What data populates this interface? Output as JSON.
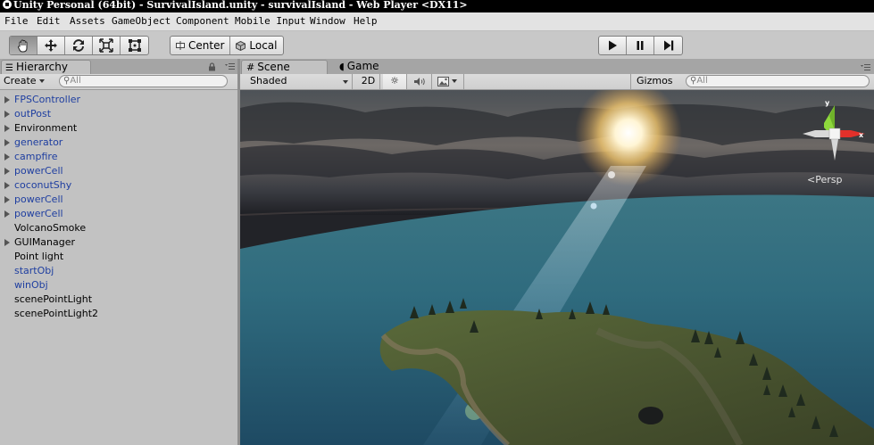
{
  "window": {
    "title": "Unity Personal (64bit) - SurvivalIsland.unity - survivalIsland - Web Player <DX11>"
  },
  "menu": [
    "File",
    "Edit",
    "Assets",
    "GameObject",
    "Component",
    "Mobile Input",
    "Window",
    "Help"
  ],
  "toolbar": {
    "tools": [
      "hand-tool-icon",
      "move-tool-icon",
      "rotate-tool-icon",
      "scale-tool-icon",
      "rect-tool-icon"
    ],
    "active_tool": "hand-tool-icon",
    "pivot_label": "Center",
    "space_label": "Local",
    "playback": [
      "play-icon",
      "pause-icon",
      "step-icon"
    ]
  },
  "hierarchy": {
    "tab_label": "Hierarchy",
    "create_label": "Create",
    "search_placeholder": "All",
    "items": [
      {
        "label": "FPSController",
        "expandable": true,
        "prefab": true
      },
      {
        "label": "outPost",
        "expandable": true,
        "prefab": true
      },
      {
        "label": "Environment",
        "expandable": true,
        "prefab": false
      },
      {
        "label": "generator",
        "expandable": true,
        "prefab": true
      },
      {
        "label": "campfire",
        "expandable": true,
        "prefab": true
      },
      {
        "label": "powerCell",
        "expandable": true,
        "prefab": true
      },
      {
        "label": "coconutShy",
        "expandable": true,
        "prefab": true
      },
      {
        "label": "powerCell",
        "expandable": true,
        "prefab": true
      },
      {
        "label": "powerCell",
        "expandable": true,
        "prefab": true
      },
      {
        "label": "VolcanoSmoke",
        "expandable": false,
        "prefab": false
      },
      {
        "label": "GUIManager",
        "expandable": true,
        "prefab": false
      },
      {
        "label": "Point light",
        "expandable": false,
        "prefab": false
      },
      {
        "label": "startObj",
        "expandable": false,
        "prefab": true
      },
      {
        "label": "winObj",
        "expandable": false,
        "prefab": true
      },
      {
        "label": "scenePointLight",
        "expandable": false,
        "prefab": false
      },
      {
        "label": "scenePointLight2",
        "expandable": false,
        "prefab": false
      }
    ]
  },
  "scene": {
    "scene_tab_label": "Scene",
    "game_tab_label": "Game",
    "shading_label": "Shaded",
    "mode_2d_label": "2D",
    "gizmos_label": "Gizmos",
    "search_placeholder": "All",
    "gizmo_y_label": "y",
    "gizmo_x_label": "x",
    "projection_label": "Persp"
  },
  "colors": {
    "prefab_text": "#1e3ea0",
    "gizmo_y": "#8ed83c",
    "gizmo_x": "#e2302a",
    "ocean": "#2f6b7e"
  }
}
